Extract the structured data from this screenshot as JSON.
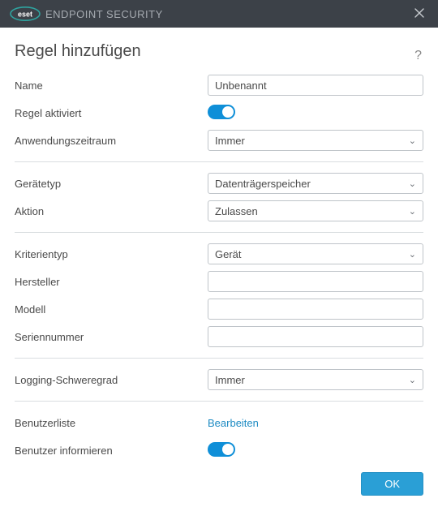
{
  "titlebar": {
    "brand_logo_text": "eset",
    "brand_text": "ENDPOINT SECURITY"
  },
  "page": {
    "title": "Regel hinzufügen"
  },
  "labels": {
    "name": "Name",
    "rule_active": "Regel aktiviert",
    "application_period": "Anwendungszeitraum",
    "device_type": "Gerätetyp",
    "action": "Aktion",
    "criteria_type": "Kriterientyp",
    "manufacturer": "Hersteller",
    "model": "Modell",
    "serial_number": "Seriennummer",
    "log_severity": "Logging-Schweregrad",
    "user_list": "Benutzerliste",
    "notify_user": "Benutzer informieren"
  },
  "values": {
    "name": "Unbenannt",
    "application_period": "Immer",
    "device_type": "Datenträgerspeicher",
    "action": "Zulassen",
    "criteria_type": "Gerät",
    "manufacturer": "",
    "model": "",
    "serial_number": "",
    "log_severity": "Immer",
    "rule_active_on": true,
    "notify_user_on": true
  },
  "actions": {
    "user_list_edit": "Bearbeiten",
    "ok": "OK"
  }
}
